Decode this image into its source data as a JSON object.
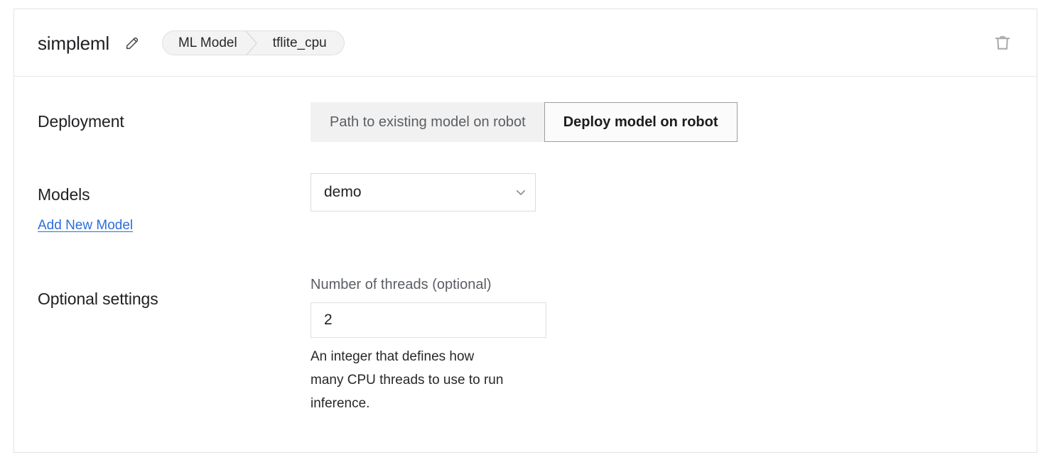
{
  "header": {
    "title": "simpleml",
    "edit_icon": "pencil-icon",
    "breadcrumb": {
      "first": "ML Model",
      "last": "tflite_cpu"
    },
    "delete_icon": "trash-icon"
  },
  "body": {
    "deployment": {
      "label": "Deployment",
      "options": [
        {
          "label": "Path to existing model on robot",
          "selected": false
        },
        {
          "label": "Deploy model on robot",
          "selected": true
        }
      ]
    },
    "models": {
      "label": "Models",
      "add_link": "Add New Model",
      "select_value": "demo",
      "select_icon": "chevron-down-icon"
    },
    "optional_settings": {
      "label": "Optional settings",
      "threads_label": "Number of threads (optional)",
      "threads_value": "2",
      "threads_placeholder": "",
      "threads_helper": "An integer that defines how many CPU threads to use to run inference."
    }
  },
  "colors": {
    "link": "#2b6ede",
    "card_border": "#e3e3e3",
    "selected_border": "#9b9da0",
    "muted_text": "#5a5e63"
  }
}
